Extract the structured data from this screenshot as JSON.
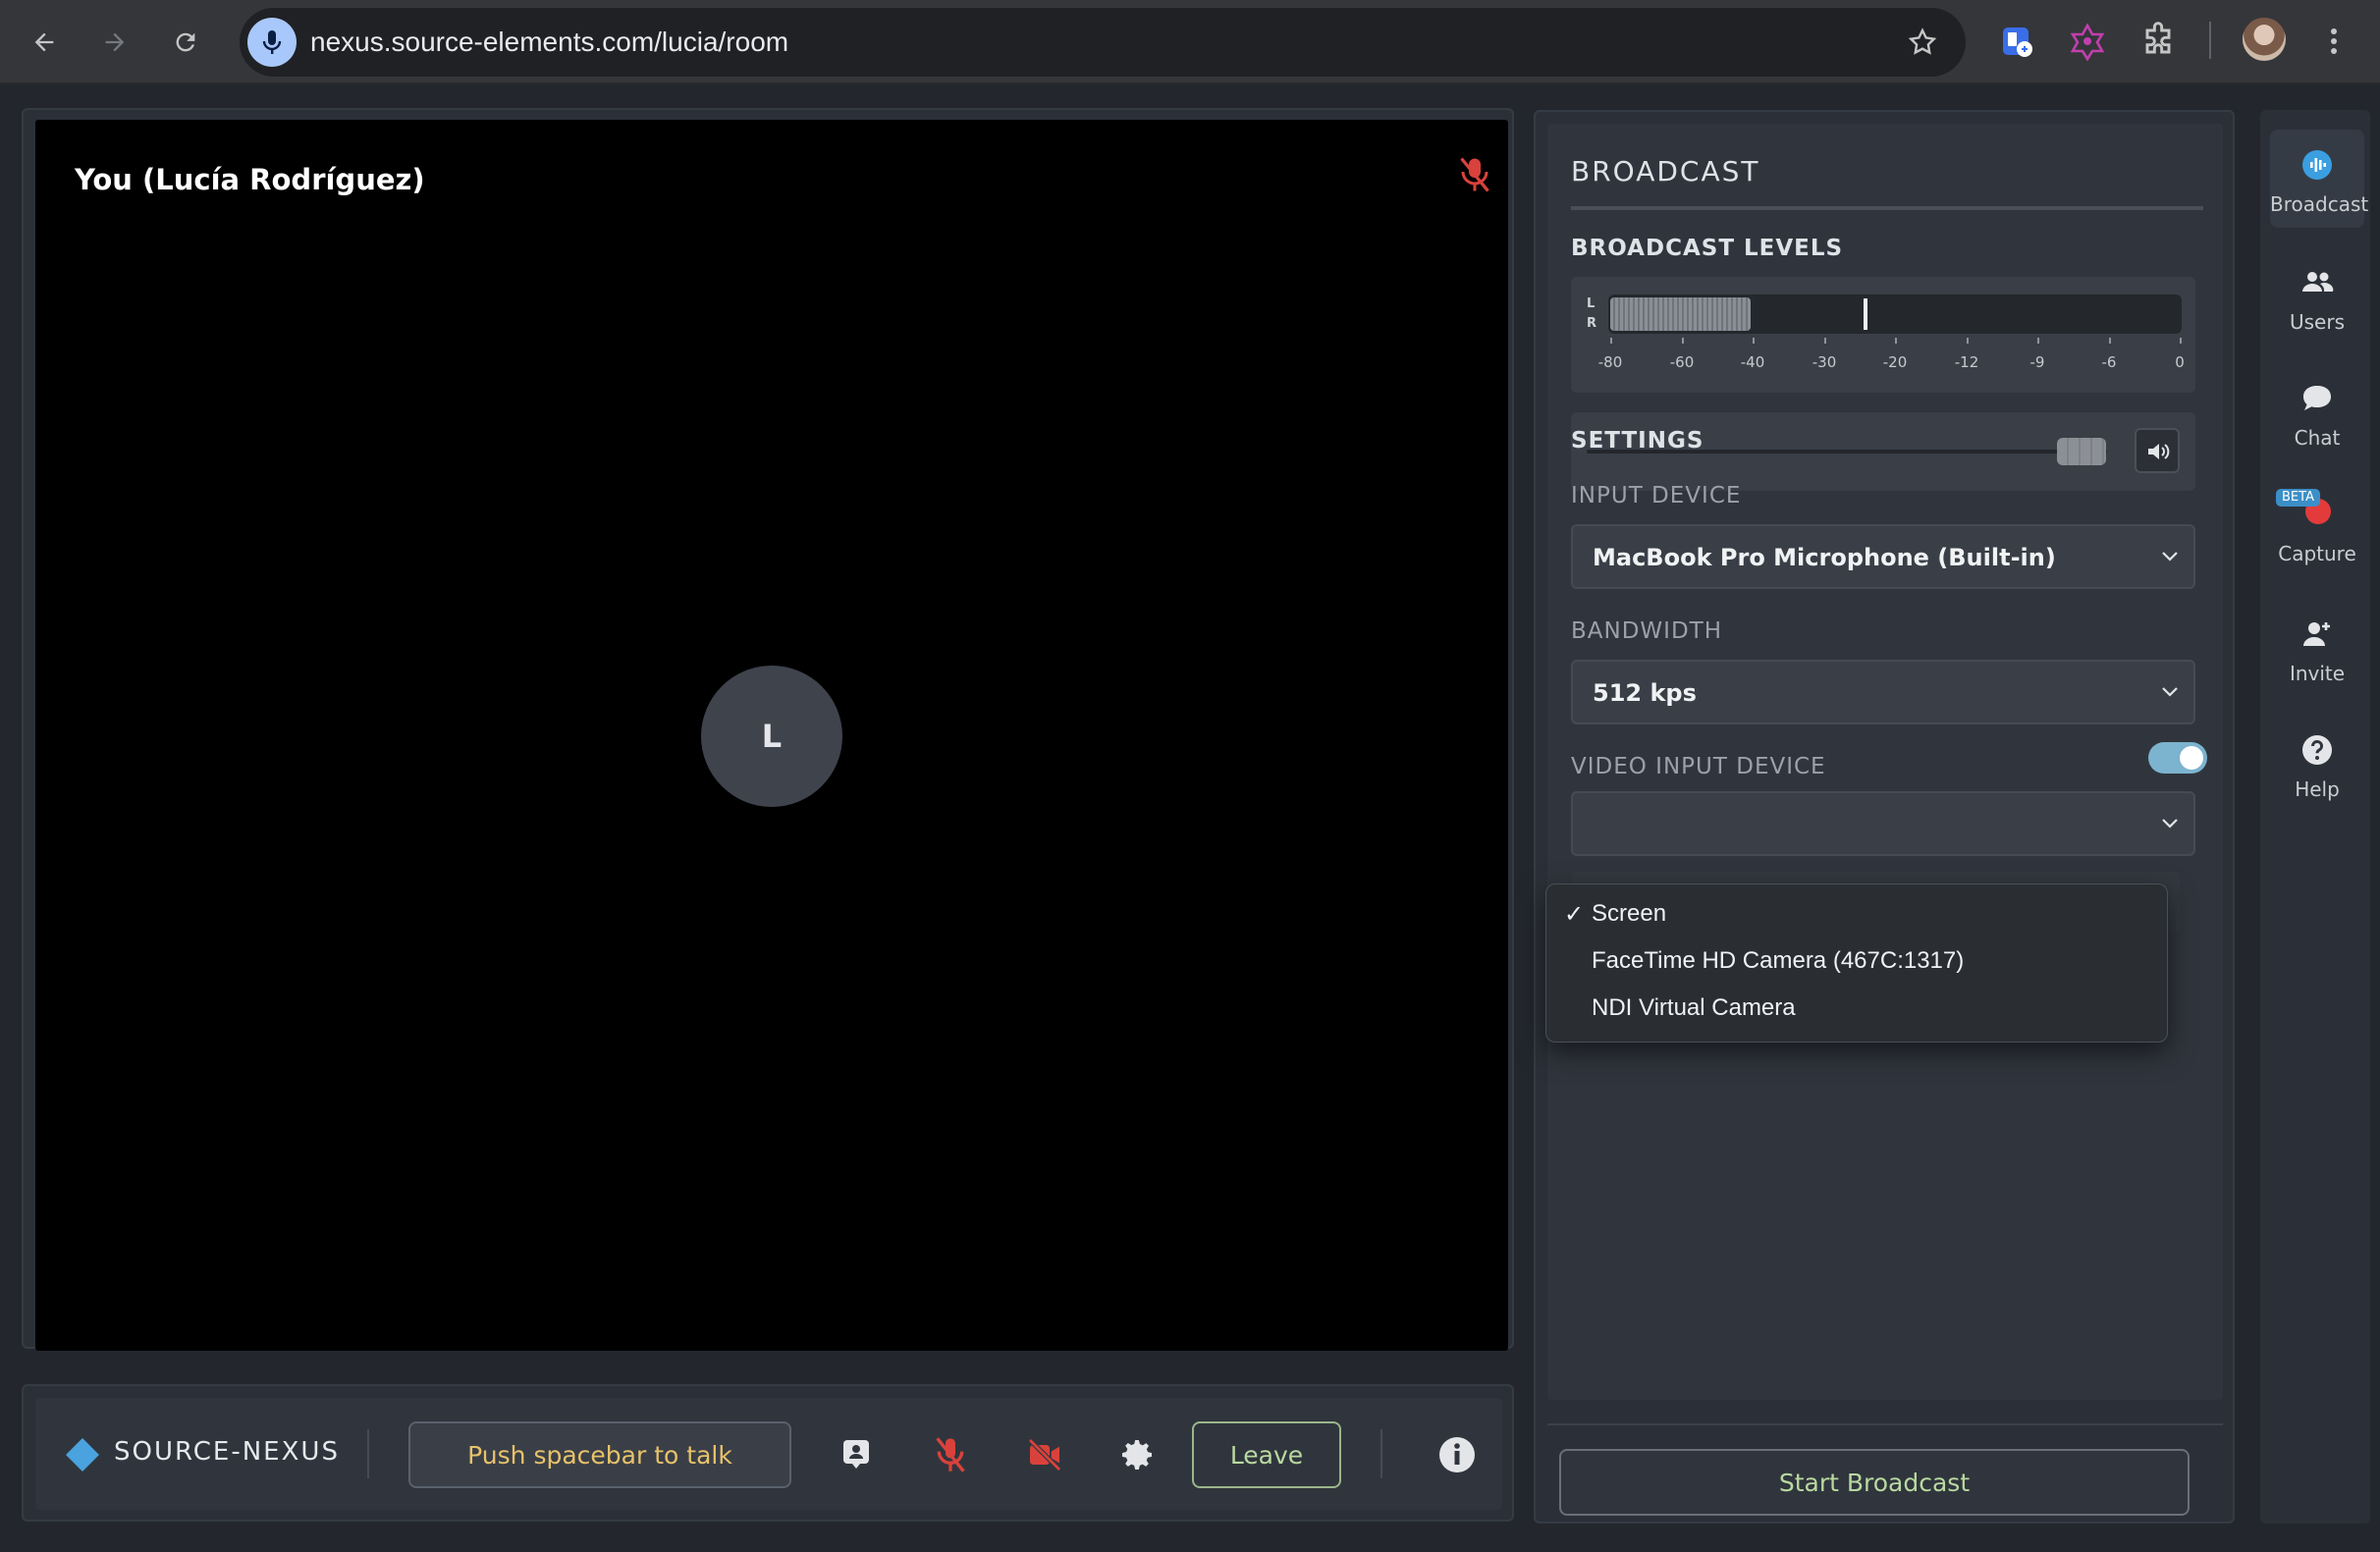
{
  "browser": {
    "url": "nexus.source-elements.com/lucia/room",
    "icons": [
      "back-arrow-icon",
      "forward-arrow-icon",
      "reload-icon",
      "microphone-icon",
      "star-icon",
      "extension-icon",
      "puzzle-icon",
      "more-vert-icon"
    ]
  },
  "video": {
    "participant_name": "You (Lucía Rodríguez)",
    "avatar_initial": "L",
    "muted_icon": "mic-off-icon"
  },
  "toolbar": {
    "brand": "SOURCE-NEXUS",
    "push_to_talk_label": "Push spacebar to talk",
    "leave_label": "Leave",
    "icons": [
      "user-card-icon",
      "mic-off-icon",
      "camera-off-icon",
      "gear-icon",
      "info-icon"
    ]
  },
  "broadcast_panel": {
    "title": "BROADCAST",
    "levels_heading": "BROADCAST LEVELS",
    "meter": {
      "channel_left": "L",
      "channel_right": "R",
      "scale": [
        "-80",
        "-60",
        "-40",
        "-30",
        "-20",
        "-12",
        "-9",
        "-6",
        "0"
      ],
      "level_fraction": 0.245,
      "peak_fraction": 0.445
    },
    "volume": {
      "level_fraction": 0.95,
      "icon": "speaker-icon"
    },
    "settings_heading": "SETTINGS",
    "input_device_label": "INPUT DEVICE",
    "input_device_value": "MacBook Pro Microphone (Built-in)",
    "bandwidth_label": "BANDWIDTH",
    "bandwidth_value": "512 kps",
    "video_input_label": "VIDEO INPUT DEVICE",
    "video_input_enabled": true,
    "video_options": [
      {
        "label": "Screen",
        "selected": true
      },
      {
        "label": "FaceTime HD Camera (467C:1317)",
        "selected": false
      },
      {
        "label": "NDI Virtual Camera",
        "selected": false
      }
    ],
    "check_mark": "✓",
    "start_label": "Start Broadcast"
  },
  "rail": {
    "items": [
      {
        "label": "Broadcast",
        "icon": "broadcast-icon",
        "active": true
      },
      {
        "label": "Users",
        "icon": "users-icon",
        "active": false
      },
      {
        "label": "Chat",
        "icon": "chat-icon",
        "active": false
      },
      {
        "label": "Capture",
        "icon": "record-icon",
        "active": false,
        "badge": "BETA"
      },
      {
        "label": "Invite",
        "icon": "add-user-icon",
        "active": false
      },
      {
        "label": "Help",
        "icon": "help-icon",
        "active": false
      }
    ]
  },
  "colors": {
    "accent_blue": "#4aa3df",
    "danger_red": "#e33b3b",
    "push_to_talk_text": "#e8c26a",
    "positive_text": "#b9d9a0"
  }
}
